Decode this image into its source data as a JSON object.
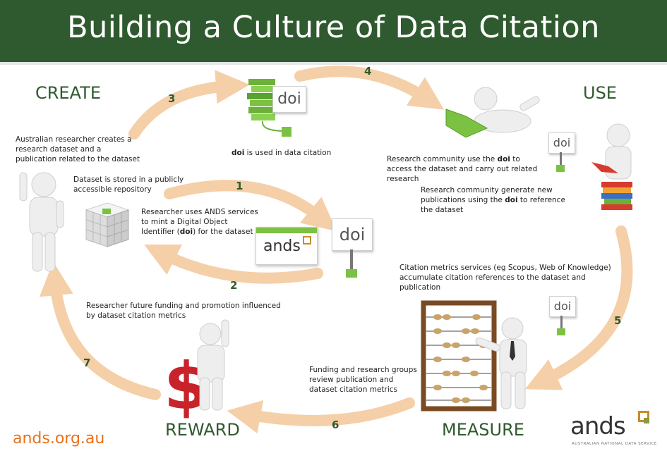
{
  "title": "Building a Culture of Data Citation",
  "stages": {
    "create": "CREATE",
    "use": "USE",
    "measure": "MEASURE",
    "reward": "REWARD"
  },
  "steps": {
    "s1": "1",
    "s2": "2",
    "s3": "3",
    "s4": "4",
    "s5": "5",
    "s6": "6",
    "s7": "7"
  },
  "notes": {
    "create_dataset": "Australian researcher creates a research dataset and a publication related to the dataset",
    "stored": "Dataset is stored in a publicly accessible repository",
    "mint_a": "Researcher uses ANDS services to mint a Digital Object Identifier (",
    "mint_doi": "doi",
    "mint_b": ") for the dataset",
    "used_doi": "doi",
    "used_rest": " is used in data citation",
    "access_a": "Research community use the ",
    "access_doi": "doi",
    "access_b": " to access the dataset and carry out related research",
    "generate_a": "Research community generate new publications using the ",
    "generate_doi": "doi",
    "generate_b": " to reference the dataset",
    "metrics": "Citation metrics services (eg Scopus, Web of Knowledge) accumulate citation references to the dataset and publication",
    "funding_review": "Funding and research groups review publication and dataset citation metrics",
    "future_funding": "Researcher future funding and promotion influenced by dataset citation metrics"
  },
  "doi_label": "doi",
  "ands_card_word": "ands",
  "footer_url": "ands.org.au",
  "logo": {
    "word": "ands",
    "subtitle": "AUSTRALIAN NATIONAL DATA SERVICE"
  },
  "colors": {
    "banner": "#2f5a2f",
    "stage_text": "#2f5a2f",
    "arrow": "#f5cfa7",
    "url": "#e8711c",
    "green_accent": "#7cc242"
  }
}
